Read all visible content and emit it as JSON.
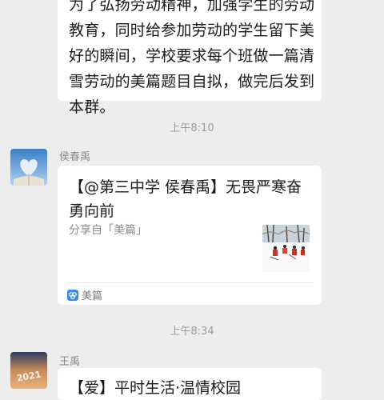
{
  "messages": {
    "top_text": "为了弘扬劳动精神，加强学生的劳动教育，同时给参加劳动的学生留下美好的瞬间，学校要求每个班做一篇清雪劳动的美篇题目自拟，做完后发到本群。",
    "time1": "上午8:10",
    "sender1": "侯春禹",
    "card": {
      "title": "【@第三中学 侯春禹】无畏严寒奋勇向前",
      "share": "分享自「美篇」",
      "source": "美篇"
    },
    "time2": "上午8:34",
    "sender2": "王禹",
    "bottom_text": "【爱】平时生活·温情校园"
  }
}
